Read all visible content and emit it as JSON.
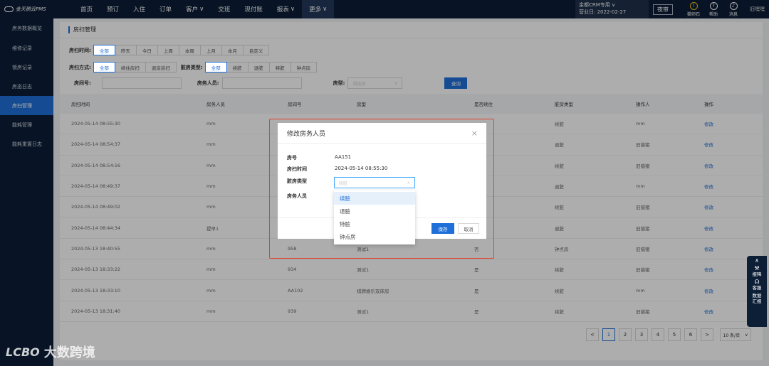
{
  "app": {
    "logo_text": "金天鹅云PMS"
  },
  "nav": {
    "items": [
      {
        "label": "首页"
      },
      {
        "label": "预订"
      },
      {
        "label": "入住"
      },
      {
        "label": "订单"
      },
      {
        "label": "客户",
        "caret": "∨"
      },
      {
        "label": "交班"
      },
      {
        "label": "现付账"
      },
      {
        "label": "报表",
        "caret": "∨"
      },
      {
        "label": "更多",
        "caret": "∨"
      }
    ]
  },
  "top": {
    "crm": "金都CRM专用",
    "crm_caret": "∨",
    "business_day": "营业日: 2022-02-27",
    "review": "夜审",
    "icons": [
      {
        "icon": "warning-icon",
        "label": "猫师石"
      },
      {
        "icon": "help-icon",
        "label": "帮助"
      },
      {
        "icon": "bell-icon",
        "label": "消息"
      }
    ],
    "badge": "",
    "user": "旧嘿嘿"
  },
  "sidebar": {
    "items": [
      {
        "label": "房务数据概览"
      },
      {
        "label": "维修记录"
      },
      {
        "label": "锁房记录"
      },
      {
        "label": "房态日志"
      },
      {
        "label": "房扫管理"
      },
      {
        "label": "能耗管理"
      },
      {
        "label": "能耗重置日志"
      }
    ]
  },
  "page": {
    "title": "房扫管理"
  },
  "filters": {
    "time_label": "房扫时间:",
    "time_opts": [
      "全部",
      "昨天",
      "今日",
      "上周",
      "本周",
      "上月",
      "本月",
      "自定义"
    ],
    "mode_label": "房扫方式:",
    "mode_opts": [
      "全部",
      "续住房扫",
      "退房房扫"
    ],
    "type_label": "脏房类型:",
    "type_opts": [
      "全部",
      "续脏",
      "退脏",
      "特脏",
      "钟点房"
    ],
    "room_label": "房间号:",
    "staff_label": "房务人员:",
    "roomtype_label": "房型:",
    "roomtype_placeholder": "请选择",
    "query": "查询"
  },
  "table": {
    "headers": [
      "房扫时间",
      "房务人员",
      "房间号",
      "房型",
      "是否续住",
      "脏房类型",
      "操作人",
      "操作"
    ],
    "rows": [
      [
        "2024-05-14 08:55:30",
        "mm",
        "",
        "",
        "",
        "续脏",
        "mm",
        "修改"
      ],
      [
        "2024-05-14 08:54:37",
        "mm",
        "",
        "",
        "",
        "退脏",
        "旧猎猪",
        "修改"
      ],
      [
        "2024-05-14 08:54:16",
        "mm",
        "",
        "",
        "",
        "续脏",
        "旧猎猪",
        "修改"
      ],
      [
        "2024-05-14 08:49:37",
        "mm",
        "",
        "",
        "",
        "退脏",
        "mm",
        "修改"
      ],
      [
        "2024-05-14 08:49:02",
        "mm",
        "",
        "",
        "",
        "续脏",
        "旧猎猪",
        "修改"
      ],
      [
        "2024-05-14 08:44:34",
        "提早1",
        "",
        "",
        "",
        "退脏",
        "旧猎猪",
        "修改"
      ],
      [
        "2024-05-13 18:40:55",
        "mm",
        "958",
        "测试1",
        "否",
        "钟点房",
        "旧猎猪",
        "修改"
      ],
      [
        "2024-05-13 18:33:22",
        "mm",
        "934",
        "测试1",
        "是",
        "续脏",
        "旧猎猪",
        "修改"
      ],
      [
        "2024-05-13 18:33:10",
        "mm",
        "AA102",
        "棋牌娱乐双床房",
        "是",
        "续脏",
        "mm",
        "修改"
      ],
      [
        "2024-05-13 18:31:40",
        "mm",
        "939",
        "测试1",
        "是",
        "续脏",
        "旧猎猪",
        "修改"
      ]
    ]
  },
  "pager": {
    "pages": [
      "1",
      "2",
      "3",
      "4",
      "5",
      "6"
    ],
    "prev": "<",
    "next": ">",
    "size": "10 条/页",
    "size_caret": "∨"
  },
  "modal": {
    "title": "修改房务人员",
    "close": "×",
    "room_label": "房号",
    "room_value": "AA151",
    "time_label": "房扫时间",
    "time_value": "2024-05-14 08:55:30",
    "type_label": "脏房类型",
    "type_placeholder": "续脏",
    "staff_label": "房务人员",
    "save": "保存",
    "cancel": "取消"
  },
  "dropdown": {
    "options": [
      "续脏",
      "退脏",
      "特脏",
      "钟点房"
    ],
    "selected": 0
  },
  "float_panel": {
    "items": [
      {
        "icon": "wrench-icon",
        "label": "报障"
      },
      {
        "icon": "headset-icon",
        "label": "客服"
      },
      {
        "icon": "report-icon",
        "label": "数据 汇报"
      }
    ],
    "up": "∧"
  },
  "watermark": {
    "logo": "LCBO",
    "text": "大数跨境"
  },
  "colors": {
    "primary": "#1e6fd9",
    "nav_bg": "#0d1e37",
    "highlight": "#e8412c"
  }
}
